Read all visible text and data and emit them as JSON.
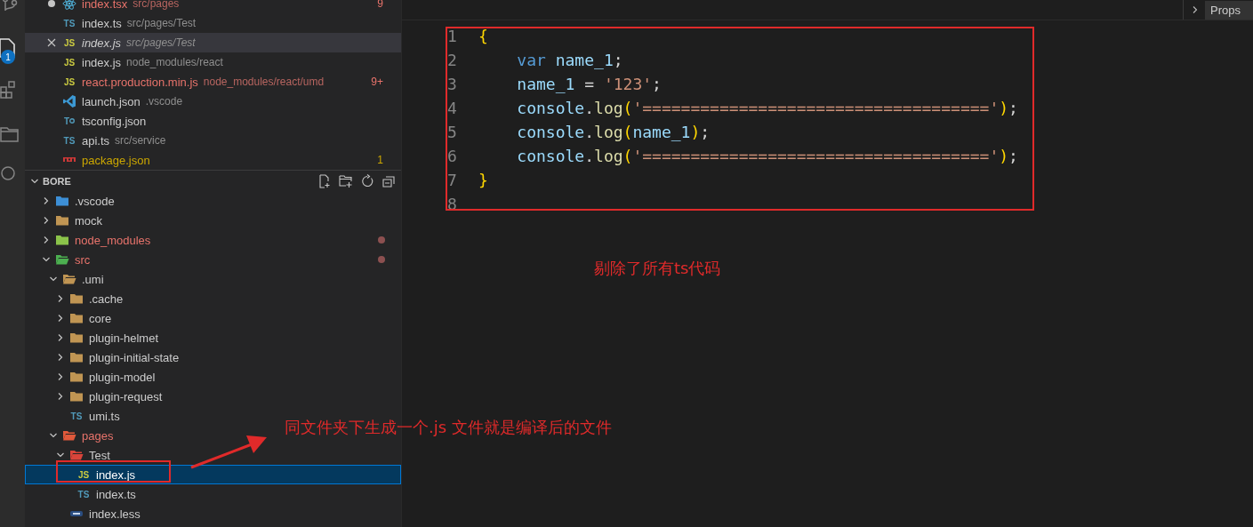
{
  "activity_bar": {
    "badge": "1"
  },
  "open_editors": [
    {
      "icon": {
        "kind": "react"
      },
      "name": "index.tsx",
      "path": "src/pages",
      "error": true,
      "warning": false,
      "badge": "9",
      "dirty": true,
      "selected": false,
      "preview": false
    },
    {
      "icon": {
        "kind": "ts",
        "text": "TS"
      },
      "name": "index.ts",
      "path": "src/pages/Test",
      "error": false,
      "warning": false,
      "dirty": false,
      "selected": false,
      "preview": false
    },
    {
      "icon": {
        "kind": "js",
        "text": "JS"
      },
      "name": "index.js",
      "path": "src/pages/Test",
      "error": false,
      "warning": false,
      "dirty": false,
      "selected": true,
      "preview": true
    },
    {
      "icon": {
        "kind": "js",
        "text": "JS"
      },
      "name": "index.js",
      "path": "node_modules/react",
      "error": false,
      "warning": false,
      "dirty": false,
      "selected": false,
      "preview": false
    },
    {
      "icon": {
        "kind": "js",
        "text": "JS"
      },
      "name": "react.production.min.js",
      "path": "node_modules/react/umd",
      "error": true,
      "warning": false,
      "badge": "9+",
      "dirty": false,
      "selected": false,
      "preview": false
    },
    {
      "icon": {
        "kind": "vscode"
      },
      "name": "launch.json",
      "path": ".vscode",
      "error": false,
      "warning": false,
      "dirty": false,
      "selected": false,
      "preview": false
    },
    {
      "icon": {
        "kind": "tsconfig",
        "text": "T"
      },
      "name": "tsconfig.json",
      "error": false,
      "warning": false,
      "dirty": false,
      "selected": false,
      "preview": false
    },
    {
      "icon": {
        "kind": "ts",
        "text": "TS"
      },
      "name": "api.ts",
      "path": "src/service",
      "error": false,
      "warning": false,
      "dirty": false,
      "selected": false,
      "preview": false
    },
    {
      "icon": {
        "kind": "npm"
      },
      "name": "package.json",
      "error": false,
      "warning": true,
      "badge": "1",
      "dirty": false,
      "selected": false,
      "preview": false
    }
  ],
  "explorer": {
    "title": "BORE",
    "expanded": true,
    "tree": [
      {
        "name": ".vscode",
        "kind": "folder",
        "icon": {
          "kind": "vscode-folder"
        },
        "expanded": false,
        "error": false,
        "dot": false,
        "selected": false
      },
      {
        "name": "mock",
        "kind": "folder",
        "icon": {
          "kind": "folder"
        },
        "expanded": false,
        "error": false,
        "dot": false,
        "selected": false
      },
      {
        "name": "node_modules",
        "kind": "folder",
        "icon": {
          "kind": "node-folder"
        },
        "expanded": false,
        "error": true,
        "dot": true,
        "selected": false
      },
      {
        "name": "src",
        "kind": "folder",
        "icon": {
          "kind": "src-folder"
        },
        "expanded": true,
        "error": true,
        "dot": true,
        "selected": false,
        "children": [
          {
            "name": ".umi",
            "kind": "folder",
            "icon": {
              "kind": "folder"
            },
            "expanded": true,
            "error": false,
            "dot": false,
            "selected": false,
            "children": [
              {
                "name": ".cache",
                "kind": "folder",
                "icon": {
                  "kind": "folder"
                },
                "expanded": false,
                "error": false,
                "dot": false,
                "selected": false
              },
              {
                "name": "core",
                "kind": "folder",
                "icon": {
                  "kind": "folder"
                },
                "expanded": false,
                "error": false,
                "dot": false,
                "selected": false
              },
              {
                "name": "plugin-helmet",
                "kind": "folder",
                "icon": {
                  "kind": "folder"
                },
                "expanded": false,
                "error": false,
                "dot": false,
                "selected": false
              },
              {
                "name": "plugin-initial-state",
                "kind": "folder",
                "icon": {
                  "kind": "folder"
                },
                "expanded": false,
                "error": false,
                "dot": false,
                "selected": false
              },
              {
                "name": "plugin-model",
                "kind": "folder",
                "icon": {
                  "kind": "folder"
                },
                "expanded": false,
                "error": false,
                "dot": false,
                "selected": false
              },
              {
                "name": "plugin-request",
                "kind": "folder",
                "icon": {
                  "kind": "folder"
                },
                "expanded": false,
                "error": false,
                "dot": false,
                "selected": false
              },
              {
                "name": "umi.ts",
                "kind": "file",
                "icon": {
                  "kind": "ts",
                  "text": "TS"
                },
                "error": false,
                "dot": false,
                "selected": false
              }
            ]
          },
          {
            "name": "pages",
            "kind": "folder",
            "icon": {
              "kind": "pages-folder"
            },
            "expanded": true,
            "error": true,
            "dot": false,
            "selected": false,
            "children": [
              {
                "name": "Test",
                "kind": "folder",
                "icon": {
                  "kind": "test-folder"
                },
                "expanded": true,
                "error": false,
                "dot": false,
                "selected": false,
                "children": [
                  {
                    "name": "index.js",
                    "kind": "file",
                    "icon": {
                      "kind": "js",
                      "text": "JS"
                    },
                    "error": false,
                    "dot": false,
                    "selected": true
                  },
                  {
                    "name": "index.ts",
                    "kind": "file",
                    "icon": {
                      "kind": "ts",
                      "text": "TS"
                    },
                    "error": false,
                    "dot": false,
                    "selected": false
                  }
                ]
              },
              {
                "name": "index.less",
                "kind": "file",
                "icon": {
                  "kind": "less"
                },
                "error": false,
                "dot": false,
                "selected": false
              }
            ]
          }
        ]
      }
    ]
  },
  "editor": {
    "breadcrumb_button": "Props",
    "lines": [
      {
        "number": "1",
        "tokens": [
          {
            "text": "{",
            "kind": "bracket"
          }
        ]
      },
      {
        "number": "2",
        "tokens": [
          {
            "text": "    var",
            "kind": "keyword"
          },
          {
            "text": " name_1",
            "kind": "variable"
          },
          {
            "text": ";",
            "kind": "plain"
          }
        ]
      },
      {
        "number": "3",
        "tokens": [
          {
            "text": "    name_1",
            "kind": "variable"
          },
          {
            "text": " = ",
            "kind": "plain"
          },
          {
            "text": "'123'",
            "kind": "string"
          },
          {
            "text": ";",
            "kind": "plain"
          }
        ]
      },
      {
        "number": "4",
        "tokens": [
          {
            "text": "    console",
            "kind": "variable"
          },
          {
            "text": ".",
            "kind": "plain"
          },
          {
            "text": "log",
            "kind": "function"
          },
          {
            "text": "(",
            "kind": "bracket"
          },
          {
            "text": "'===================================='",
            "kind": "string"
          },
          {
            "text": ")",
            "kind": "bracket"
          },
          {
            "text": ";",
            "kind": "plain"
          }
        ]
      },
      {
        "number": "5",
        "tokens": [
          {
            "text": "    console",
            "kind": "variable"
          },
          {
            "text": ".",
            "kind": "plain"
          },
          {
            "text": "log",
            "kind": "function"
          },
          {
            "text": "(",
            "kind": "bracket"
          },
          {
            "text": "name_1",
            "kind": "variable"
          },
          {
            "text": ")",
            "kind": "bracket"
          },
          {
            "text": ";",
            "kind": "plain"
          }
        ]
      },
      {
        "number": "6",
        "tokens": [
          {
            "text": "    console",
            "kind": "variable"
          },
          {
            "text": ".",
            "kind": "plain"
          },
          {
            "text": "log",
            "kind": "function"
          },
          {
            "text": "(",
            "kind": "bracket"
          },
          {
            "text": "'===================================='",
            "kind": "string"
          },
          {
            "text": ")",
            "kind": "bracket"
          },
          {
            "text": ";",
            "kind": "plain"
          }
        ]
      },
      {
        "number": "7",
        "tokens": [
          {
            "text": "}",
            "kind": "bracket"
          }
        ]
      },
      {
        "number": "8"
      }
    ]
  },
  "annotations": [
    {
      "kind": "box"
    },
    {
      "kind": "note",
      "text": "剔除了所有ts代码"
    },
    {
      "kind": "note",
      "text": "同文件夹下生成一个.js 文件就是编译后的文件"
    },
    {
      "kind": "arrow"
    },
    {
      "kind": "box"
    }
  ]
}
